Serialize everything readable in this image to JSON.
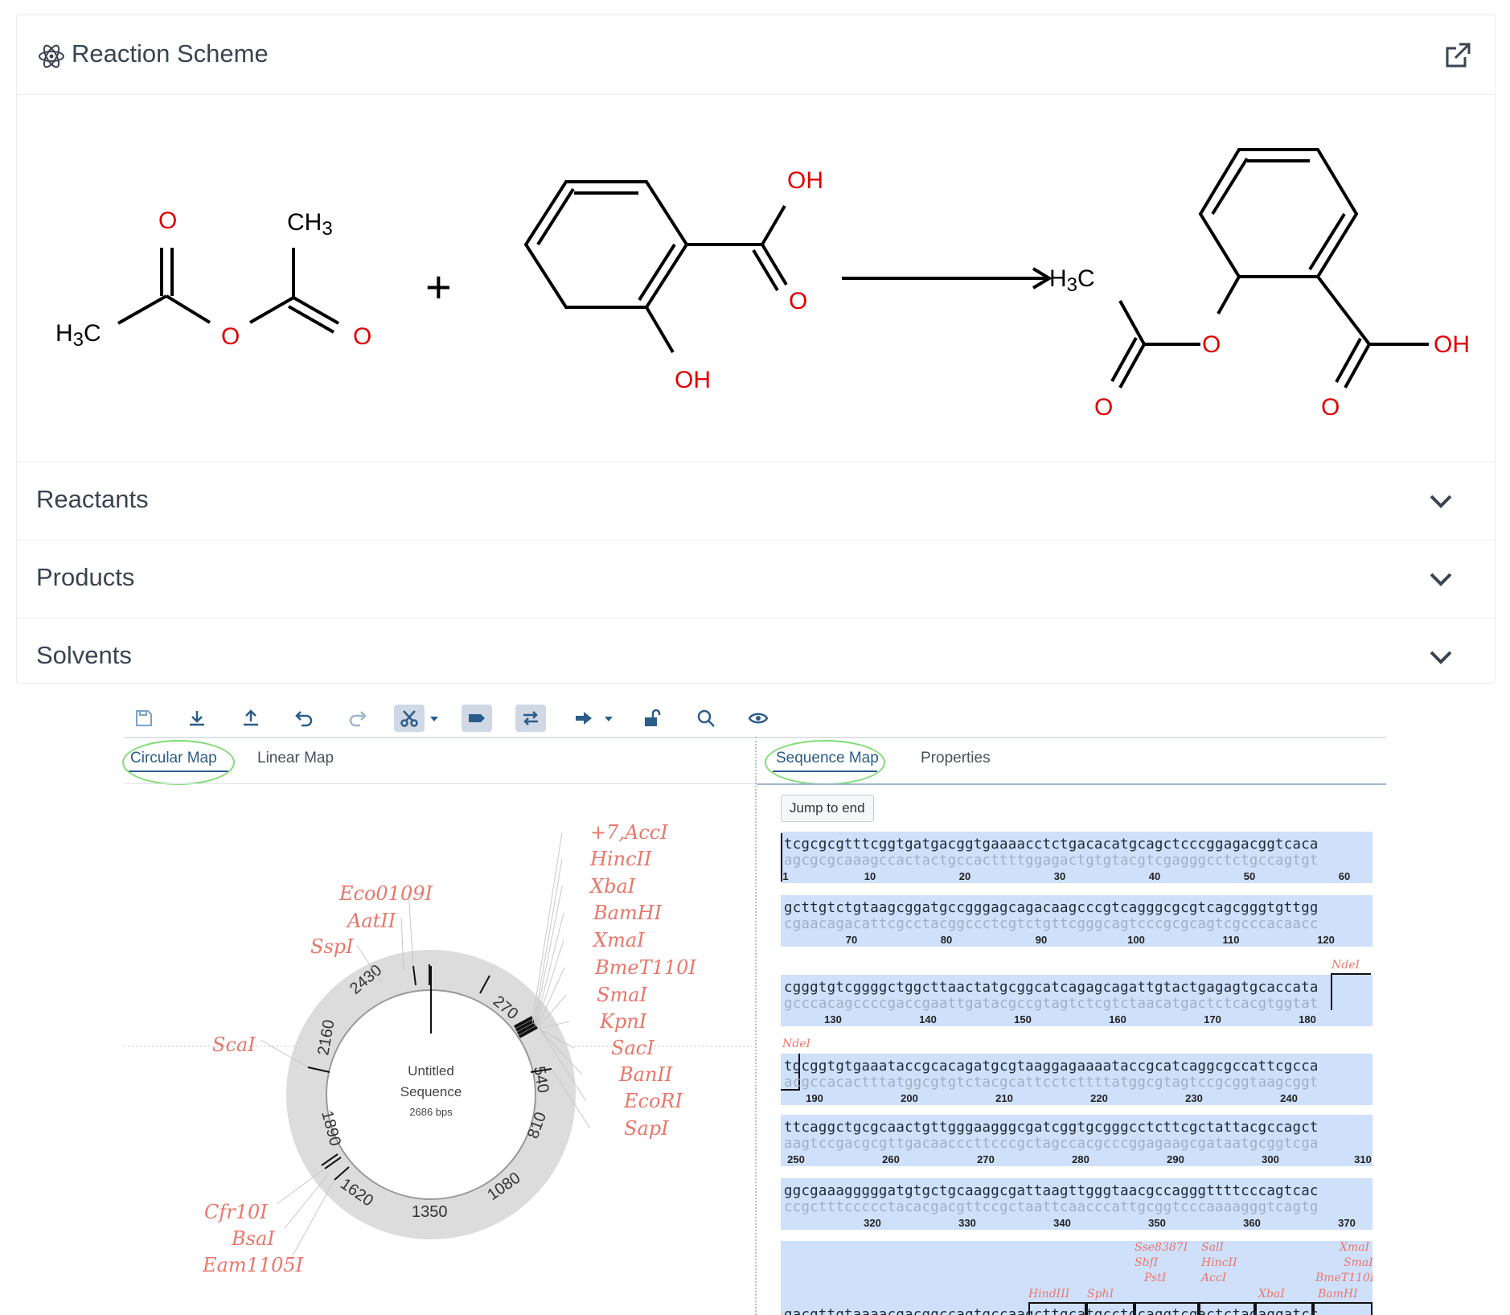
{
  "reaction": {
    "title": "Reaction Scheme",
    "plus": "+",
    "accordion": [
      {
        "label": "Reactants"
      },
      {
        "label": "Products"
      },
      {
        "label": "Solvents"
      }
    ],
    "labels": {
      "anh_o1": "O",
      "anh_ch3": "CH3",
      "anh_h3c": "H3C",
      "anh_o2": "O",
      "anh_o3": "O",
      "sal_oh1": "OH",
      "sal_o": "O",
      "sal_oh2": "OH",
      "asp_h3c": "H3C",
      "asp_o1": "O",
      "asp_o2": "O",
      "asp_o3": "O",
      "asp_oh": "OH"
    }
  },
  "editor": {
    "left_tabs": [
      "Circular Map",
      "Linear Map"
    ],
    "right_tabs": [
      "Sequence Map",
      "Properties"
    ],
    "jump_label": "Jump to end",
    "map": {
      "name_line1": "Untitled",
      "name_line2": "Sequence",
      "length": "2686 bps",
      "ring_ticks": [
        "270",
        "540",
        "810",
        "1080",
        "1350",
        "1620",
        "1890",
        "2160",
        "2430"
      ],
      "enzymes_right": [
        "+7,AccI",
        "HincII",
        "XbaI",
        "BamHI",
        "XmaI",
        "BmeT110I",
        "SmaI",
        "KpnI",
        "SacI",
        "BanII",
        "EcoRI",
        "SapI"
      ],
      "enzymes_top": [
        "Eco0109I",
        "AatII",
        "SspI"
      ],
      "enzymes_left": [
        "ScaI"
      ],
      "enzymes_bottom": [
        "Cfr10I",
        "BsaI",
        "Eam1105I"
      ]
    },
    "sequence_rows": [
      {
        "top": "tcgcgcgtttcggtgatgacggtgaaaacctctgacacatgcagctcccggagacggtcaca",
        "bottom": "agcgcgcaaagccactactgccacttttggagactgtgtacgtcgagggcctctgccagtgt",
        "ticks": [
          "1",
          "10",
          "20",
          "30",
          "40",
          "50",
          "60"
        ]
      },
      {
        "top": "gcttgtctgtaagcggatgccgggagcagacaagcccgtcagggcgcgtcagcgggtgttgg",
        "bottom": "cgaacagacattcgcctacggccctcgtctgttcgggcagtcccgcgcagtcgcccacaacc",
        "ticks": [
          "70",
          "80",
          "90",
          "100",
          "110",
          "120"
        ]
      },
      {
        "top": "cgggtgtcggggctggcttaactatgcggcatcagagcagattgtactgagagtgcaccata",
        "bottom": "gcccacagccccgaccgaattgatacgccgtagtctcgtctaacatgactctcacgtggtat",
        "ticks": [
          "130",
          "140",
          "150",
          "160",
          "170",
          "180"
        ]
      },
      {
        "top": "tgcggtgtgaaataccgcacagatgcgtaaggagaaaataccgcatcaggcgccattcgcca",
        "bottom": "acgccacactttatggcgtgtctacgcattcctcttttatggcgtagtccgcggtaagcggt",
        "ticks": [
          "190",
          "200",
          "210",
          "220",
          "230",
          "240"
        ]
      },
      {
        "top": "ttcaggctgcgcaactgttgggaagggcgatcggtgcgggcctcttcgctattacgccagct",
        "bottom": "aagtccgacgcgttgacaacccttcccgctagccacgcccggagaagcgataatgcggtcga",
        "ticks": [
          "250",
          "260",
          "270",
          "280",
          "290",
          "300",
          "310"
        ]
      },
      {
        "top": "ggcgaaagggggatgtgctgcaaggcgattaagttgggtaacgccagggttttcccagtcac",
        "bottom": "ccgctttccccctacacgacgttccgctaattcaacccattgcggtcccaaaagggtcagtg",
        "ticks": [
          "320",
          "330",
          "340",
          "350",
          "360",
          "370"
        ]
      },
      {
        "top": "gacgttgtaaaacgacggccagtgccaagcttgcatgcctgcaggtcgactctagaggatcc",
        "bottom": "ctgcaacattttgctgccggtcacggttcgaacgtacggacgtccagctgagatctcctagg",
        "ticks": []
      }
    ],
    "row_enzymes": {
      "row3": [
        "NdeI"
      ],
      "row4": [
        "NdeI"
      ],
      "row7": [
        "Sse8387I",
        "SalI",
        "SbfI",
        "HincII",
        "PstI",
        "AccI",
        "HindIII",
        "SphI",
        "XbaI",
        "BamHI",
        "XmaI",
        "SmaI",
        "BmeT110I"
      ]
    }
  }
}
